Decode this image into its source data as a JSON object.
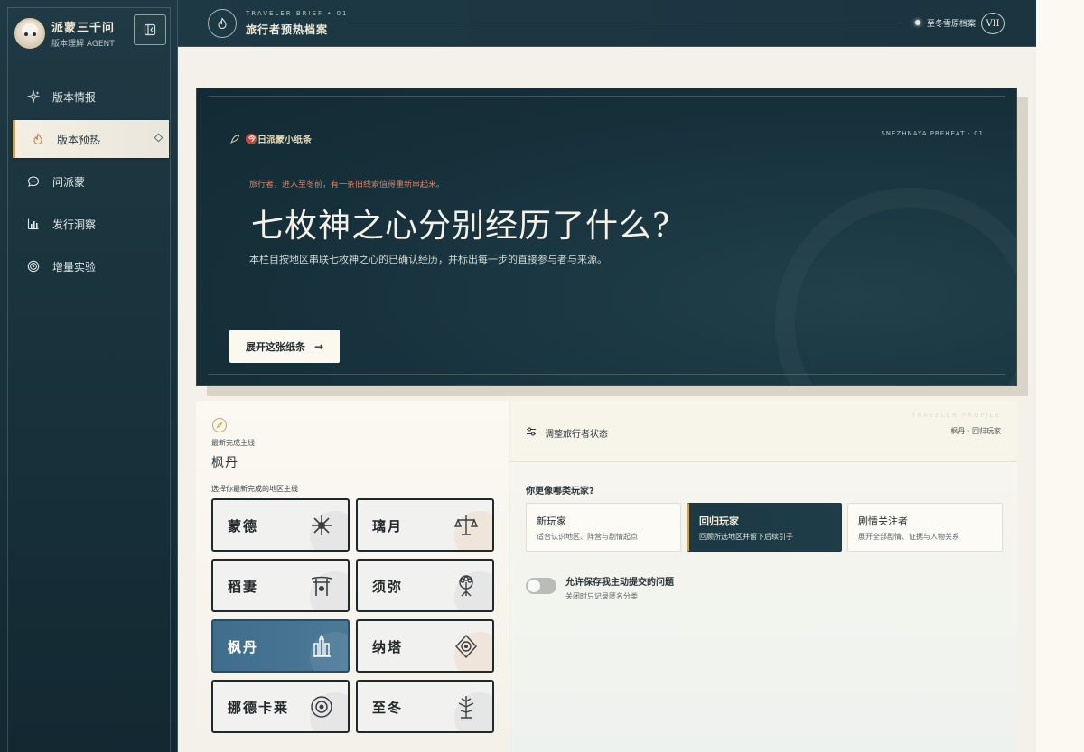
{
  "sidebar": {
    "brand_title": "派蒙三千问",
    "brand_sub": "版本理解 AGENT",
    "items": [
      {
        "label": "版本情报",
        "icon": "sparkle-icon",
        "active": false
      },
      {
        "label": "版本预热",
        "icon": "flame-icon",
        "active": true
      },
      {
        "label": "问派蒙",
        "icon": "chat-bubble-icon",
        "active": false
      },
      {
        "label": "发行洞察",
        "icon": "bar-chart-icon",
        "active": false
      },
      {
        "label": "增量实验",
        "icon": "target-icon",
        "active": false
      }
    ]
  },
  "topbar": {
    "eyebrow": "TRAVELER BRIEF • 01",
    "title": "旅行者预热档案",
    "status": "至冬雪原档案",
    "badge": "VII"
  },
  "hero": {
    "note_label_a": "今",
    "note_label_b": "日派蒙小纸条",
    "code": "SNEZHNAYA PREHEAT · 01",
    "eyebrow": "旅行者，进入至冬前，有一条旧线索值得重新串起来。",
    "title": "七枚神之心分别经历了什么?",
    "desc": "本栏目按地区串联七枚神之心的已确认经历，并标出每一步的直接参与者与来源。",
    "button_label": "展开这张纸条",
    "button_arrow": "→"
  },
  "region_panel": {
    "label": "最新完成主线",
    "value": "枫丹",
    "hint": "选择你最新完成的地区主线",
    "regions": [
      {
        "name": "蒙德",
        "emblem": "mondstadt-emblem-icon",
        "selected": false
      },
      {
        "name": "璃月",
        "emblem": "liyue-emblem-icon",
        "selected": false
      },
      {
        "name": "稻妻",
        "emblem": "inazuma-emblem-icon",
        "selected": false
      },
      {
        "name": "须弥",
        "emblem": "sumeru-emblem-icon",
        "selected": false
      },
      {
        "name": "枫丹",
        "emblem": "fontaine-emblem-icon",
        "selected": true
      },
      {
        "name": "纳塔",
        "emblem": "natlan-emblem-icon",
        "selected": false
      },
      {
        "name": "挪德卡莱",
        "emblem": "nod-krai-emblem-icon",
        "selected": false
      },
      {
        "name": "至冬",
        "emblem": "snezhnaya-emblem-icon",
        "selected": false
      }
    ]
  },
  "status_panel": {
    "watermark": "TRAVELER PROFILE",
    "title": "调整旅行者状态",
    "subtitle": "枫丹 · 回归玩家",
    "question": "你更像哪类玩家?",
    "options": [
      {
        "title": "新玩家",
        "desc": "适合认识地区、阵营与剧情起点",
        "selected": false
      },
      {
        "title": "回归玩家",
        "desc": "回顾所选地区并留下后续引子",
        "selected": true
      },
      {
        "title": "剧情关注者",
        "desc": "展开全部剧情、证据与人物关系",
        "selected": false
      }
    ],
    "toggle_title": "允许保存我主动提交的问题",
    "toggle_desc": "关闭时只记录匿名分类",
    "toggle_on": false
  },
  "colors": {
    "sidebar_bg": "#1f3a44",
    "accent_gold": "#c9a25b",
    "selected_region": "#4b7a97",
    "hero_bg": "#17323c"
  }
}
